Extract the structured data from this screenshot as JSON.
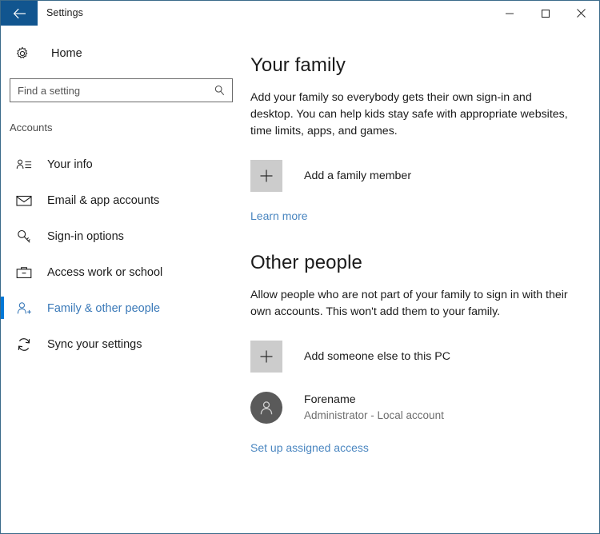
{
  "window": {
    "title": "Settings",
    "back_icon": "back-arrow-icon",
    "controls": [
      {
        "name": "minimize",
        "label": "—"
      },
      {
        "name": "maximize",
        "label": "□"
      },
      {
        "name": "close",
        "label": "✕"
      }
    ]
  },
  "sidebar": {
    "home_label": "Home",
    "home_icon": "gear-icon",
    "search": {
      "placeholder": "Find a setting",
      "value": "",
      "icon": "search-icon"
    },
    "group_header": "Accounts",
    "items": [
      {
        "label": "Your info",
        "icon": "your-info-icon",
        "selected": false
      },
      {
        "label": "Email & app accounts",
        "icon": "envelope-icon",
        "selected": false
      },
      {
        "label": "Sign-in options",
        "icon": "key-icon",
        "selected": false
      },
      {
        "label": "Access work or school",
        "icon": "briefcase-icon",
        "selected": false
      },
      {
        "label": "Family & other people",
        "icon": "person-add-icon",
        "selected": true
      },
      {
        "label": "Sync your settings",
        "icon": "sync-icon",
        "selected": false
      }
    ]
  },
  "main": {
    "family": {
      "heading": "Your family",
      "description": "Add your family so everybody gets their own sign-in and desktop. You can help kids stay safe with appropriate websites, time limits, apps, and games.",
      "add_button_label": "Add a family member",
      "add_button_icon": "plus-icon",
      "learn_more_label": "Learn more"
    },
    "other_people": {
      "heading": "Other people",
      "description": "Allow people who are not part of your family to sign in with their own accounts. This won't add them to your family.",
      "add_button_label": "Add someone else to this PC",
      "add_button_icon": "plus-icon",
      "account": {
        "name": "Forename",
        "detail": "Administrator - Local account",
        "avatar_icon": "person-icon"
      },
      "assigned_access_label": "Set up assigned access"
    }
  },
  "colors": {
    "accent": "#0078d7",
    "back_button_bg": "#11558f",
    "link": "#4a86c0",
    "selected_text": "#3a79b8",
    "plus_box_bg": "#cccccc",
    "avatar_bg": "#5a5a5a"
  }
}
